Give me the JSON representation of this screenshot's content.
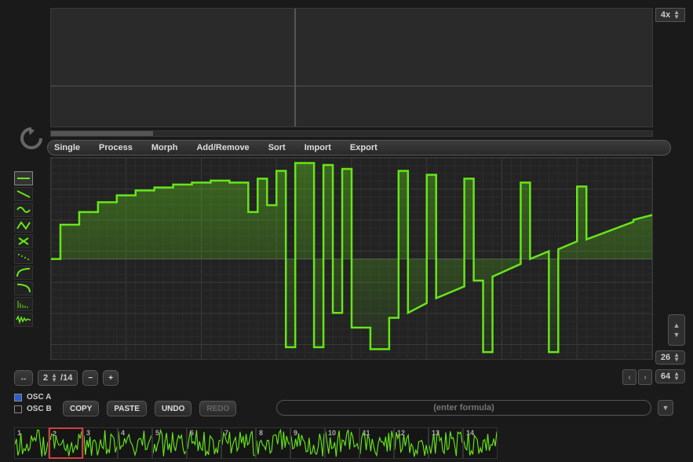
{
  "zoom": {
    "label": "4x"
  },
  "menu": {
    "items": [
      "Single",
      "Process",
      "Morph",
      "Add/Remove",
      "Sort",
      "Import",
      "Export"
    ]
  },
  "tools": [
    {
      "name": "line-flat-icon"
    },
    {
      "name": "line-down-icon"
    },
    {
      "name": "sine-icon"
    },
    {
      "name": "zigzag-icon"
    },
    {
      "name": "cross-icon"
    },
    {
      "name": "dots-icon"
    },
    {
      "name": "curve-up-icon"
    },
    {
      "name": "curve-down-icon"
    },
    {
      "name": "harmonics-icon"
    },
    {
      "name": "waveform-icon"
    }
  ],
  "grid_vertical": {
    "label": "26"
  },
  "frame_selector": {
    "current": "2",
    "total": "/14"
  },
  "buttons": {
    "minus": "−",
    "plus": "+",
    "copy": "COPY",
    "paste": "PASTE",
    "undo": "UNDO",
    "redo": "REDO",
    "width_icon": "↔"
  },
  "nav": {
    "prev": "‹",
    "next": "›"
  },
  "grid_horizontal": {
    "label": "64"
  },
  "osc": {
    "a": "OSC A",
    "b": "OSC B"
  },
  "formula": {
    "placeholder": "(enter formula)"
  },
  "frames": [
    {
      "n": "1"
    },
    {
      "n": "2"
    },
    {
      "n": "3"
    },
    {
      "n": "4"
    },
    {
      "n": "5"
    },
    {
      "n": "6"
    },
    {
      "n": "7"
    },
    {
      "n": "8"
    },
    {
      "n": "9"
    },
    {
      "n": "10"
    },
    {
      "n": "11"
    },
    {
      "n": "12"
    },
    {
      "n": "13"
    },
    {
      "n": "14"
    }
  ],
  "waveform": {
    "color": "#66e619",
    "points": [
      [
        0,
        0.0
      ],
      [
        1,
        0.0
      ],
      [
        1,
        -0.35
      ],
      [
        3,
        -0.35
      ],
      [
        3,
        -0.48
      ],
      [
        5,
        -0.48
      ],
      [
        5,
        -0.58
      ],
      [
        7,
        -0.58
      ],
      [
        7,
        -0.65
      ],
      [
        9,
        -0.65
      ],
      [
        9,
        -0.7
      ],
      [
        11,
        -0.7
      ],
      [
        11,
        -0.73
      ],
      [
        13,
        -0.73
      ],
      [
        13,
        -0.76
      ],
      [
        15,
        -0.76
      ],
      [
        15,
        -0.78
      ],
      [
        17,
        -0.78
      ],
      [
        17,
        -0.8
      ],
      [
        19,
        -0.8
      ],
      [
        19,
        -0.78
      ],
      [
        21,
        -0.78
      ],
      [
        21,
        -0.48
      ],
      [
        22,
        -0.48
      ],
      [
        22,
        -0.82
      ],
      [
        23,
        -0.82
      ],
      [
        23,
        -0.55
      ],
      [
        24,
        -0.55
      ],
      [
        24,
        -0.9
      ],
      [
        25,
        -0.9
      ],
      [
        25,
        0.9
      ],
      [
        26,
        0.9
      ],
      [
        26,
        -0.98
      ],
      [
        28,
        -0.98
      ],
      [
        28,
        0.9
      ],
      [
        29,
        0.9
      ],
      [
        29,
        -0.96
      ],
      [
        30,
        -0.96
      ],
      [
        30,
        0.55
      ],
      [
        31,
        0.55
      ],
      [
        31,
        -0.92
      ],
      [
        32,
        -0.92
      ],
      [
        32,
        0.7
      ],
      [
        34,
        0.7
      ],
      [
        34,
        0.92
      ],
      [
        36,
        0.92
      ],
      [
        36,
        0.6
      ],
      [
        37,
        0.6
      ],
      [
        37,
        -0.9
      ],
      [
        38,
        -0.9
      ],
      [
        38,
        0.55
      ],
      [
        40,
        0.45
      ],
      [
        40,
        -0.86
      ],
      [
        41,
        -0.86
      ],
      [
        41,
        0.4
      ],
      [
        44,
        0.28
      ],
      [
        44,
        -0.82
      ],
      [
        45,
        -0.82
      ],
      [
        45,
        0.22
      ],
      [
        46,
        0.22
      ],
      [
        46,
        0.95
      ],
      [
        47,
        0.95
      ],
      [
        47,
        0.18
      ],
      [
        50,
        0.05
      ],
      [
        50,
        -0.78
      ],
      [
        51,
        -0.78
      ],
      [
        51,
        0.0
      ],
      [
        53,
        -0.08
      ],
      [
        53,
        0.95
      ],
      [
        54,
        0.95
      ],
      [
        54,
        -0.1
      ],
      [
        56,
        -0.18
      ],
      [
        56,
        -0.74
      ],
      [
        57,
        -0.74
      ],
      [
        57,
        -0.2
      ],
      [
        62,
        -0.38
      ],
      [
        62,
        -0.4
      ],
      [
        64,
        -0.45
      ]
    ]
  }
}
